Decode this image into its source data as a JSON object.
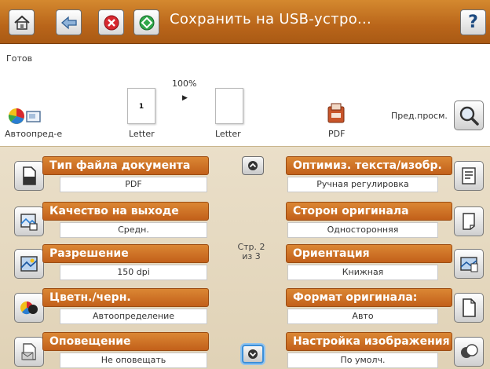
{
  "titlebar": {
    "title": "Сохранить на USB-устро...",
    "help_label": "?"
  },
  "status": {
    "text": "Готов"
  },
  "preview": {
    "zoom": "100%",
    "color_mode_label": "Автоопред-е",
    "page1_number": "1",
    "page1_size": "Letter",
    "page2_size": "Letter",
    "file_type_label": "PDF",
    "preview_label": "Пред.просм."
  },
  "settings": {
    "left": [
      {
        "label": "Тип файла документа",
        "value": "PDF"
      },
      {
        "label": "Качество на выходе",
        "value": "Средн."
      },
      {
        "label": "Разрешение",
        "value": "150 dpi"
      },
      {
        "label": "Цветн./черн.",
        "value": "Автоопределение"
      },
      {
        "label": "Оповещение",
        "value": "Не оповещать"
      }
    ],
    "right": [
      {
        "label": "Оптимиз. текста/изобр.",
        "value": "Ручная регулировка"
      },
      {
        "label": "Сторон оригинала",
        "value": "Односторонняя"
      },
      {
        "label": "Ориентация",
        "value": "Книжная"
      },
      {
        "label": "Формат оригинала:",
        "value": "Авто"
      },
      {
        "label": "Настройка изображения",
        "value": "По умолч."
      }
    ],
    "page_line1": "Стр. 2",
    "page_line2": "из 3"
  },
  "colors": {
    "titlebar": "#c06a1e",
    "label_orange": "#cf6f25",
    "panel_bg": "#e6d9bf",
    "focus_blue": "#3b8fd9"
  }
}
